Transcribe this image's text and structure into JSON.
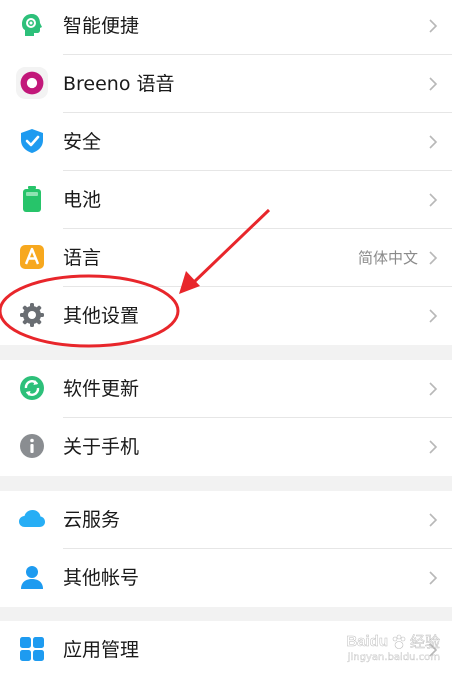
{
  "settings": {
    "group1": [
      {
        "label": "智能便捷",
        "icon": "smart-assist-icon"
      },
      {
        "label": "Breeno 语音",
        "icon": "breeno-voice-icon"
      },
      {
        "label": "安全",
        "icon": "shield-check-icon"
      },
      {
        "label": "电池",
        "icon": "battery-icon"
      },
      {
        "label": "语言",
        "icon": "language-a-icon",
        "value": "简体中文"
      },
      {
        "label": "其他设置",
        "icon": "gear-icon"
      }
    ],
    "group2": [
      {
        "label": "软件更新",
        "icon": "update-icon"
      },
      {
        "label": "关于手机",
        "icon": "info-icon"
      }
    ],
    "group3": [
      {
        "label": "云服务",
        "icon": "cloud-icon"
      },
      {
        "label": "其他帐号",
        "icon": "person-icon"
      }
    ],
    "group4": [
      {
        "label": "应用管理",
        "icon": "app-grid-icon"
      }
    ]
  },
  "annotation": {
    "arrow_color": "#e8262b",
    "circle_color": "#e8262b",
    "highlighted_item": "其他设置"
  },
  "colors": {
    "smart": "#2dc07a",
    "breeno": "#c2187a",
    "shield": "#1e9bf0",
    "battery": "#27c46a",
    "language": "#f7a81e",
    "gear": "#6a6e73",
    "update": "#2dc07a",
    "info": "#8a8d91",
    "cloud": "#27aef5",
    "person": "#1e9bf0",
    "apps": "#1e9bf0"
  },
  "watermark": {
    "brand": "Baidu",
    "jingyan": "经验",
    "url": "jingyan.baidu.com"
  }
}
